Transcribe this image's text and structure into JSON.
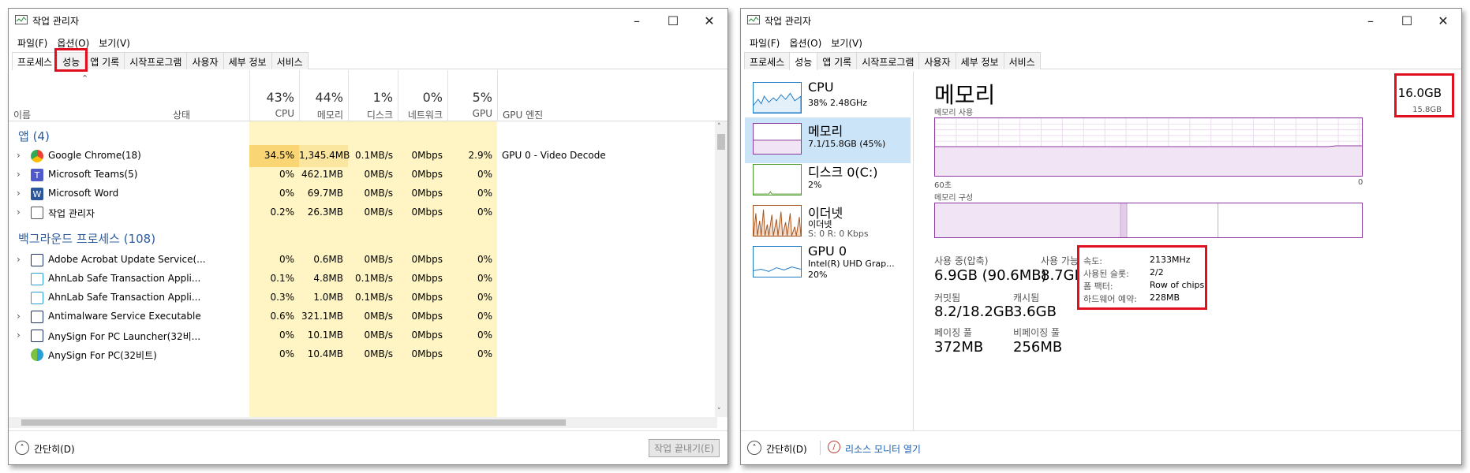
{
  "w1": {
    "title": "작업 관리자",
    "menu": [
      "파일(F)",
      "옵션(O)",
      "보기(V)"
    ],
    "tabs": [
      "프로세스",
      "성능",
      "앱 기록",
      "시작프로그램",
      "사용자",
      "세부 정보",
      "서비스"
    ],
    "header": {
      "name": "이름",
      "status": "상태",
      "cpu_pct": "43%",
      "cpu_label": "CPU",
      "mem_pct": "44%",
      "mem_label": "메모리",
      "disk_pct": "1%",
      "disk_label": "디스크",
      "net_pct": "0%",
      "net_label": "네트워크",
      "gpu_pct": "5%",
      "gpu_label": "GPU",
      "gpu_engine": "GPU 엔진"
    },
    "group_apps": "앱 (4)",
    "group_bg": "백그라운드 프로세스 (108)",
    "apps": [
      {
        "name": "Google Chrome(18)",
        "cpu": "34.5%",
        "mem": "1,345.4MB",
        "disk": "0.1MB/s",
        "net": "0Mbps",
        "gpu": "2.9%",
        "engine": "GPU 0 - Video Decode"
      },
      {
        "name": "Microsoft Teams(5)",
        "cpu": "0%",
        "mem": "462.1MB",
        "disk": "0MB/s",
        "net": "0Mbps",
        "gpu": "0%",
        "engine": ""
      },
      {
        "name": "Microsoft Word",
        "cpu": "0%",
        "mem": "69.7MB",
        "disk": "0MB/s",
        "net": "0Mbps",
        "gpu": "0%",
        "engine": ""
      },
      {
        "name": "작업 관리자",
        "cpu": "0.2%",
        "mem": "26.3MB",
        "disk": "0MB/s",
        "net": "0Mbps",
        "gpu": "0%",
        "engine": ""
      }
    ],
    "bg": [
      {
        "name": "Adobe Acrobat Update Service(...",
        "cpu": "0%",
        "mem": "0.6MB",
        "disk": "0MB/s",
        "net": "0Mbps",
        "gpu": "0%"
      },
      {
        "name": "AhnLab Safe Transaction Appli...",
        "cpu": "0.1%",
        "mem": "4.8MB",
        "disk": "0.1MB/s",
        "net": "0Mbps",
        "gpu": "0%"
      },
      {
        "name": "AhnLab Safe Transaction Appli...",
        "cpu": "0.3%",
        "mem": "1.0MB",
        "disk": "0.1MB/s",
        "net": "0Mbps",
        "gpu": "0%"
      },
      {
        "name": "Antimalware Service Executable",
        "cpu": "0.6%",
        "mem": "321.1MB",
        "disk": "0MB/s",
        "net": "0Mbps",
        "gpu": "0%"
      },
      {
        "name": "AnySign For PC Launcher(32비...",
        "cpu": "0%",
        "mem": "10.1MB",
        "disk": "0MB/s",
        "net": "0Mbps",
        "gpu": "0%"
      },
      {
        "name": "AnySign For PC(32비트)",
        "cpu": "0%",
        "mem": "10.4MB",
        "disk": "0MB/s",
        "net": "0Mbps",
        "gpu": "0%"
      }
    ],
    "footer_less": "간단히(D)",
    "footer_end": "작업 끝내기(E)"
  },
  "w2": {
    "title": "작업 관리자",
    "menu": [
      "파일(F)",
      "옵션(O)",
      "보기(V)"
    ],
    "tabs": [
      "프로세스",
      "성능",
      "앱 기록",
      "시작프로그램",
      "사용자",
      "세부 정보",
      "서비스"
    ],
    "side": [
      {
        "name": "CPU",
        "sub": "38% 2.48GHz"
      },
      {
        "name": "메모리",
        "sub": "7.1/15.8GB (45%)"
      },
      {
        "name": "디스크 0(C:)",
        "sub": "2%"
      },
      {
        "name": "이더넷",
        "sub": "이더넷",
        "sub2": "S: 0 R: 0 Kbps"
      },
      {
        "name": "GPU 0",
        "sub": "Intel(R) UHD Grap...",
        "sub2": "20%"
      }
    ],
    "main": {
      "title": "메모리",
      "total": "16.0GB",
      "usage_label": "메모리 사용",
      "usage_max": "15.8GB",
      "time_left": "60초",
      "time_right": "0",
      "composition_label": "메모리 구성",
      "in_use_label": "사용 중(압축)",
      "in_use": "6.9GB (90.6MB)",
      "available_label": "사용 가능",
      "available": "8.7GB",
      "committed_label": "커밋됨",
      "committed": "8.2/18.2GB",
      "cached_label": "캐시됨",
      "cached": "3.6GB",
      "paged_label": "페이징 풀",
      "paged": "372MB",
      "nonpaged_label": "비페이징 풀",
      "nonpaged": "256MB",
      "speed_label": "속도:",
      "speed": "2133MHz",
      "slots_label": "사용된 슬롯:",
      "slots": "2/2",
      "form_label": "폼 팩터:",
      "form": "Row of chips",
      "hw_label": "하드웨어 예약:",
      "hw": "228MB"
    },
    "footer_less": "간단히(D)",
    "footer_monitor": "리소스 모니터 열기"
  }
}
